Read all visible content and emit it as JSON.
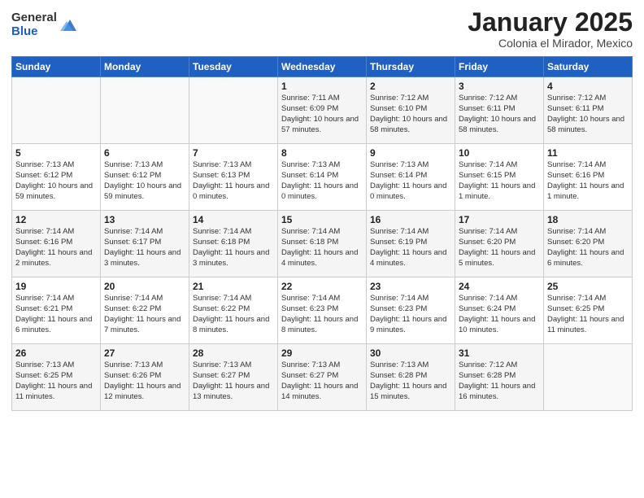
{
  "header": {
    "logo_general": "General",
    "logo_blue": "Blue",
    "month_title": "January 2025",
    "subtitle": "Colonia el Mirador, Mexico"
  },
  "weekdays": [
    "Sunday",
    "Monday",
    "Tuesday",
    "Wednesday",
    "Thursday",
    "Friday",
    "Saturday"
  ],
  "weeks": [
    [
      {
        "day": "",
        "info": ""
      },
      {
        "day": "",
        "info": ""
      },
      {
        "day": "",
        "info": ""
      },
      {
        "day": "1",
        "info": "Sunrise: 7:11 AM\nSunset: 6:09 PM\nDaylight: 10 hours and 57 minutes."
      },
      {
        "day": "2",
        "info": "Sunrise: 7:12 AM\nSunset: 6:10 PM\nDaylight: 10 hours and 58 minutes."
      },
      {
        "day": "3",
        "info": "Sunrise: 7:12 AM\nSunset: 6:11 PM\nDaylight: 10 hours and 58 minutes."
      },
      {
        "day": "4",
        "info": "Sunrise: 7:12 AM\nSunset: 6:11 PM\nDaylight: 10 hours and 58 minutes."
      }
    ],
    [
      {
        "day": "5",
        "info": "Sunrise: 7:13 AM\nSunset: 6:12 PM\nDaylight: 10 hours and 59 minutes."
      },
      {
        "day": "6",
        "info": "Sunrise: 7:13 AM\nSunset: 6:12 PM\nDaylight: 10 hours and 59 minutes."
      },
      {
        "day": "7",
        "info": "Sunrise: 7:13 AM\nSunset: 6:13 PM\nDaylight: 11 hours and 0 minutes."
      },
      {
        "day": "8",
        "info": "Sunrise: 7:13 AM\nSunset: 6:14 PM\nDaylight: 11 hours and 0 minutes."
      },
      {
        "day": "9",
        "info": "Sunrise: 7:13 AM\nSunset: 6:14 PM\nDaylight: 11 hours and 0 minutes."
      },
      {
        "day": "10",
        "info": "Sunrise: 7:14 AM\nSunset: 6:15 PM\nDaylight: 11 hours and 1 minute."
      },
      {
        "day": "11",
        "info": "Sunrise: 7:14 AM\nSunset: 6:16 PM\nDaylight: 11 hours and 1 minute."
      }
    ],
    [
      {
        "day": "12",
        "info": "Sunrise: 7:14 AM\nSunset: 6:16 PM\nDaylight: 11 hours and 2 minutes."
      },
      {
        "day": "13",
        "info": "Sunrise: 7:14 AM\nSunset: 6:17 PM\nDaylight: 11 hours and 3 minutes."
      },
      {
        "day": "14",
        "info": "Sunrise: 7:14 AM\nSunset: 6:18 PM\nDaylight: 11 hours and 3 minutes."
      },
      {
        "day": "15",
        "info": "Sunrise: 7:14 AM\nSunset: 6:18 PM\nDaylight: 11 hours and 4 minutes."
      },
      {
        "day": "16",
        "info": "Sunrise: 7:14 AM\nSunset: 6:19 PM\nDaylight: 11 hours and 4 minutes."
      },
      {
        "day": "17",
        "info": "Sunrise: 7:14 AM\nSunset: 6:20 PM\nDaylight: 11 hours and 5 minutes."
      },
      {
        "day": "18",
        "info": "Sunrise: 7:14 AM\nSunset: 6:20 PM\nDaylight: 11 hours and 6 minutes."
      }
    ],
    [
      {
        "day": "19",
        "info": "Sunrise: 7:14 AM\nSunset: 6:21 PM\nDaylight: 11 hours and 6 minutes."
      },
      {
        "day": "20",
        "info": "Sunrise: 7:14 AM\nSunset: 6:22 PM\nDaylight: 11 hours and 7 minutes."
      },
      {
        "day": "21",
        "info": "Sunrise: 7:14 AM\nSunset: 6:22 PM\nDaylight: 11 hours and 8 minutes."
      },
      {
        "day": "22",
        "info": "Sunrise: 7:14 AM\nSunset: 6:23 PM\nDaylight: 11 hours and 8 minutes."
      },
      {
        "day": "23",
        "info": "Sunrise: 7:14 AM\nSunset: 6:23 PM\nDaylight: 11 hours and 9 minutes."
      },
      {
        "day": "24",
        "info": "Sunrise: 7:14 AM\nSunset: 6:24 PM\nDaylight: 11 hours and 10 minutes."
      },
      {
        "day": "25",
        "info": "Sunrise: 7:14 AM\nSunset: 6:25 PM\nDaylight: 11 hours and 11 minutes."
      }
    ],
    [
      {
        "day": "26",
        "info": "Sunrise: 7:13 AM\nSunset: 6:25 PM\nDaylight: 11 hours and 11 minutes."
      },
      {
        "day": "27",
        "info": "Sunrise: 7:13 AM\nSunset: 6:26 PM\nDaylight: 11 hours and 12 minutes."
      },
      {
        "day": "28",
        "info": "Sunrise: 7:13 AM\nSunset: 6:27 PM\nDaylight: 11 hours and 13 minutes."
      },
      {
        "day": "29",
        "info": "Sunrise: 7:13 AM\nSunset: 6:27 PM\nDaylight: 11 hours and 14 minutes."
      },
      {
        "day": "30",
        "info": "Sunrise: 7:13 AM\nSunset: 6:28 PM\nDaylight: 11 hours and 15 minutes."
      },
      {
        "day": "31",
        "info": "Sunrise: 7:12 AM\nSunset: 6:28 PM\nDaylight: 11 hours and 16 minutes."
      },
      {
        "day": "",
        "info": ""
      }
    ]
  ]
}
